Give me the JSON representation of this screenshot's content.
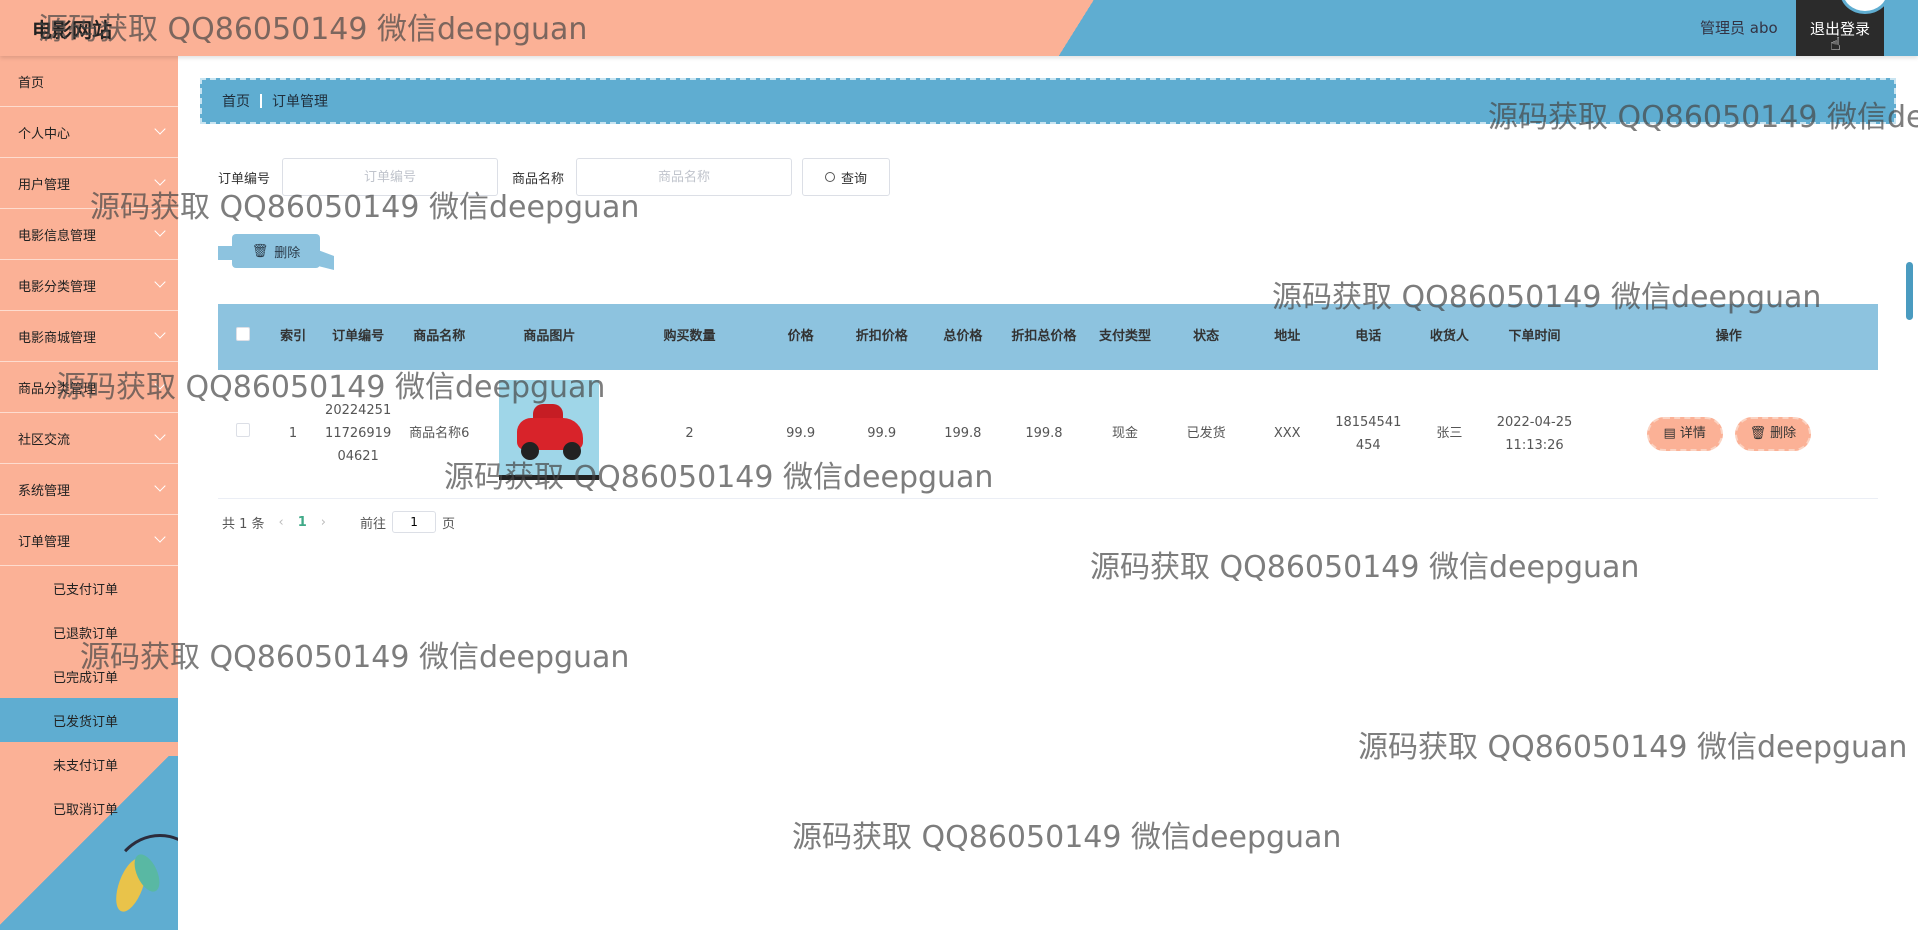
{
  "header": {
    "brand": "电影网站",
    "admin_label": "管理员 abo",
    "logout_label": "退出登录"
  },
  "sidebar": {
    "items": [
      {
        "label": "首页",
        "has_children": false
      },
      {
        "label": "个人中心",
        "has_children": true
      },
      {
        "label": "用户管理",
        "has_children": true
      },
      {
        "label": "电影信息管理",
        "has_children": true
      },
      {
        "label": "电影分类管理",
        "has_children": true
      },
      {
        "label": "电影商城管理",
        "has_children": true
      },
      {
        "label": "商品分类管理",
        "has_children": true
      },
      {
        "label": "社区交流",
        "has_children": true
      },
      {
        "label": "系统管理",
        "has_children": true
      },
      {
        "label": "订单管理",
        "has_children": true
      }
    ],
    "sub_items": [
      {
        "label": "已支付订单",
        "active": false
      },
      {
        "label": "已退款订单",
        "active": false
      },
      {
        "label": "已完成订单",
        "active": false
      },
      {
        "label": "已发货订单",
        "active": true
      },
      {
        "label": "未支付订单",
        "active": false
      },
      {
        "label": "已取消订单",
        "active": false
      }
    ]
  },
  "breadcrumb": {
    "home": "首页",
    "current": "订单管理"
  },
  "search": {
    "order_no_label": "订单编号",
    "order_no_placeholder": "订单编号",
    "order_no_value": "",
    "product_name_label": "商品名称",
    "product_name_placeholder": "商品名称",
    "product_name_value": "",
    "query_label": "查询"
  },
  "toolbar": {
    "delete_label": "删除"
  },
  "table": {
    "headers": [
      "索引",
      "订单编号",
      "商品名称",
      "商品图片",
      "购买数量",
      "价格",
      "折扣价格",
      "总价格",
      "折扣总价格",
      "支付类型",
      "状态",
      "地址",
      "电话",
      "收货人",
      "下单时间",
      "操作"
    ],
    "rows": [
      {
        "index": "1",
        "order_no": "2022425111726919 04621",
        "product_name": "商品名称6",
        "quantity": "2",
        "price": "99.9",
        "discount_price": "99.9",
        "total_price": "199.8",
        "discount_total": "199.8",
        "pay_type": "现金",
        "status": "已发货",
        "address": "XXX",
        "phone": "18154541454",
        "receiver": "张三",
        "order_time": "2022-04-25 11:13:26",
        "detail_label": "详情",
        "delete_label": "删除"
      }
    ]
  },
  "pagination": {
    "total_label": "共 1 条",
    "current_page": "1",
    "goto_label": "前往",
    "page_input": "1",
    "page_suffix": "页"
  },
  "watermark": "源码获取 QQ86050149 微信deepguan",
  "colors": {
    "salmon": "#fbb196",
    "blue": "#5fadd1",
    "light_blue": "#8dc3df",
    "dark": "#2b2b2b"
  }
}
